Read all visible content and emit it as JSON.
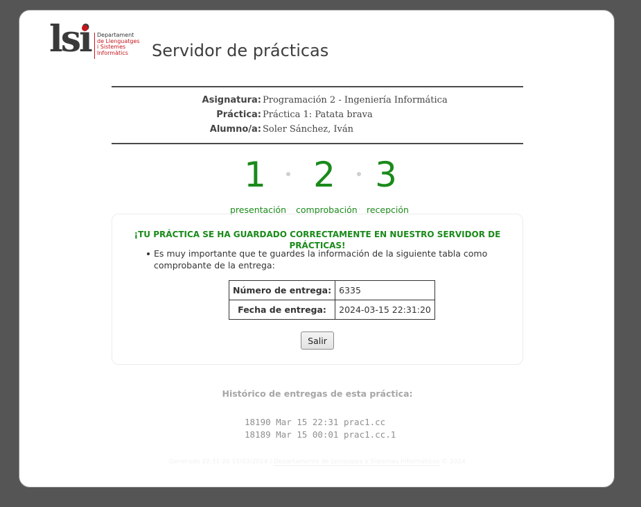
{
  "header": {
    "logo": {
      "letters": "lsi",
      "lines": [
        "Departament",
        "de Llenguatges",
        "i Sistemes",
        "Informàtics"
      ]
    },
    "title": "Servidor de prácticas"
  },
  "info": {
    "subject_label": "Asignatura:",
    "subject_value": "Programación 2 - Ingeniería Informática",
    "practice_label": "Práctica:",
    "practice_value": "Práctica 1: Patata brava",
    "student_label": "Alumno/a:",
    "student_value": "Soler Sánchez, Iván"
  },
  "steps": [
    {
      "number": "1",
      "label": "presentación"
    },
    {
      "number": "2",
      "label": "comprobación"
    },
    {
      "number": "3",
      "label": "recepción"
    }
  ],
  "step_separator": "·",
  "result": {
    "message": "¡TU PRÁCTICA SE HA GUARDADO CORRECTAMENTE EN NUESTRO SERVIDOR DE PRÁCTICAS!",
    "note": "Es muy importante que te guardes la información de la siguiente tabla como comprobante de la entrega:",
    "receipt": {
      "number_label": "Número de entrega:",
      "number_value": "6335",
      "date_label": "Fecha de entrega:",
      "date_value": "2024-03-15 22:31:20"
    },
    "exit_button": "Salir"
  },
  "history": {
    "title": "Histórico de entregas de esta práctica:",
    "entries": [
      "18190 Mar 15 22:31 prac1.cc",
      "18189 Mar 15 00:01 prac1.cc.1"
    ]
  },
  "footer": {
    "generated": "Generado 22:31:20 15/03/2024 |",
    "link": "Departamento de Lenguajes y Sistemas Informáticos",
    "year": "© 2024"
  },
  "colors": {
    "accent_green": "#1a8a1a",
    "brand_red": "#c4161c",
    "background": "#555555"
  }
}
